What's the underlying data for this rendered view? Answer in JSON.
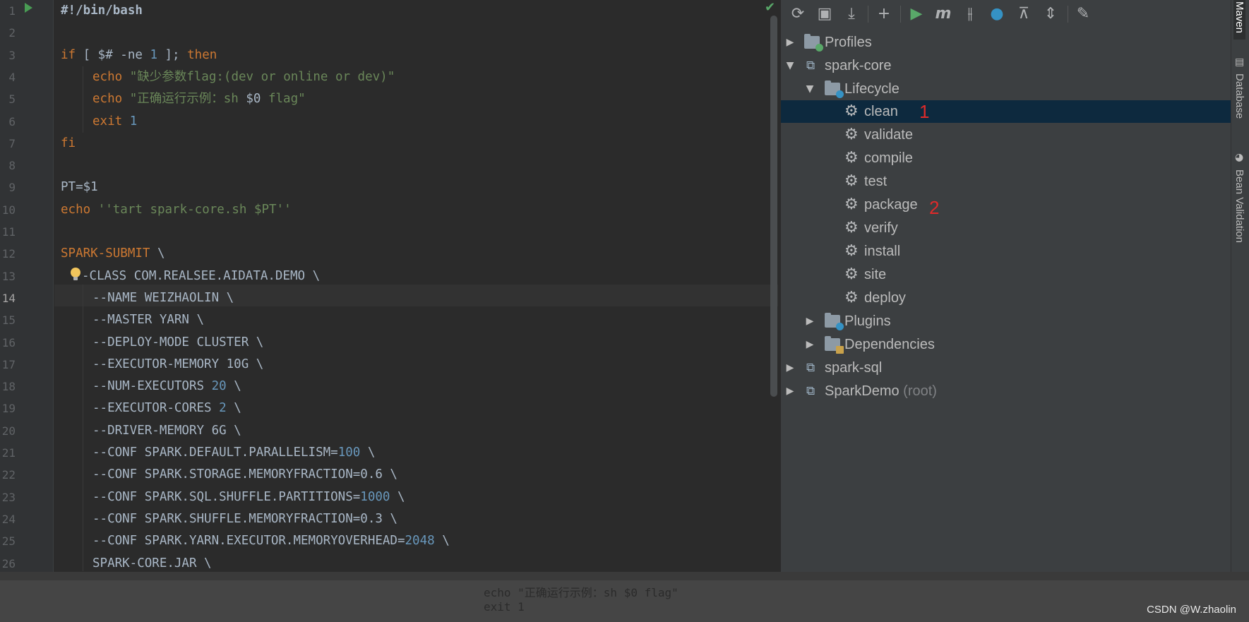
{
  "editor": {
    "line_numbers": [
      "1",
      "2",
      "3",
      "4",
      "5",
      "6",
      "7",
      "8",
      "9",
      "10",
      "11",
      "12",
      "13",
      "14",
      "15",
      "16",
      "17",
      "18",
      "19",
      "20",
      "21",
      "22",
      "23",
      "24",
      "25",
      "26"
    ],
    "current_line": "14",
    "code": {
      "l1": "#!/bin/bash",
      "l3_a": "if",
      "l3_b": " [ $# -ne ",
      "l3_c": "1",
      "l3_d": " ]; ",
      "l3_e": "then",
      "l4_a": "echo ",
      "l4_b": "\"缺少参数flag:(dev or online or dev)\"",
      "l5_a": "echo ",
      "l5_b": "\"正确运行示例：sh ",
      "l5_c": "$0",
      "l5_d": " flag\"",
      "l6_a": "exit ",
      "l6_b": "1",
      "l7": "fi",
      "l9": "PT=$1",
      "l10_a": "echo ",
      "l10_b": "''tart spark-core.sh $PT''",
      "l12_a": "SPARK-SUBMIT",
      "l12_b": " \\",
      "l13": "-CLASS COM.REALSEE.AIDATA.DEMO \\",
      "l14": "--NAME WEIZHAOLIN \\",
      "l15": "--MASTER YARN \\",
      "l16": "--DEPLOY-MODE CLUSTER \\",
      "l17": "--EXECUTOR-MEMORY 10G \\",
      "l18_a": "--NUM-EXECUTORS ",
      "l18_b": "20",
      "l18_c": " \\",
      "l19_a": "--EXECUTOR-CORES ",
      "l19_b": "2",
      "l19_c": " \\",
      "l20": "--DRIVER-MEMORY 6G \\",
      "l21_a": "--CONF SPARK.DEFAULT.PARALLELISM=",
      "l21_b": "100",
      "l21_c": " \\",
      "l22": "--CONF SPARK.STORAGE.MEMORYFRACTION=0.6 \\",
      "l23_a": "--CONF SPARK.SQL.SHUFFLE.PARTITIONS=",
      "l23_b": "1000",
      "l23_c": " \\",
      "l24": "--CONF SPARK.SHUFFLE.MEMORYFRACTION=0.3 \\",
      "l25_a": "--CONF SPARK.YARN.EXECUTOR.MEMORYOVERHEAD=",
      "l25_b": "2048",
      "l25_c": " \\",
      "l26": "SPARK-CORE.JAR \\"
    },
    "bottom_ghost": [
      "echo \"正确运行示例：sh $0 flag\"",
      "exit 1"
    ]
  },
  "maven": {
    "tree": {
      "profiles": "Profiles",
      "spark_core": "spark-core",
      "lifecycle": "Lifecycle",
      "phases": [
        "clean",
        "validate",
        "compile",
        "test",
        "package",
        "verify",
        "install",
        "site",
        "deploy"
      ],
      "plugins": "Plugins",
      "dependencies": "Dependencies",
      "spark_sql": "spark-sql",
      "spark_demo": "SparkDemo",
      "spark_demo_suffix": " (root)"
    },
    "annotations": {
      "clean_mark": "1",
      "package_mark": "2"
    },
    "selected": "clean"
  },
  "tool_windows": {
    "maven": "Maven",
    "database": "Database",
    "bean_validation": "Bean Validation"
  },
  "watermark": "CSDN @W.zhaolin",
  "colors": {
    "keyword": "#cc7832",
    "string": "#6a8759",
    "number": "#6897bb",
    "selection": "#0d293e",
    "annotation": "#e02a2a"
  }
}
